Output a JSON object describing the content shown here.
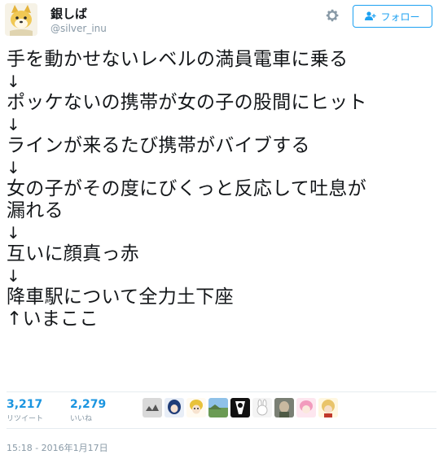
{
  "user": {
    "name": "銀しば",
    "handle": "@silver_inu",
    "follow_label": "フォロー"
  },
  "tweet": {
    "lines": [
      "手を動かせないレベルの満員電車に乗る",
      "↓",
      "ポッケないの携帯が女の子の股間にヒット",
      "↓",
      "ラインが来るたび携帯がバイブする",
      "↓",
      "女の子がその度にびくっと反応して吐息が",
      "漏れる",
      "↓",
      "互いに顔真っ赤",
      "↓",
      "降車駅について全力土下座",
      "↑いまここ"
    ]
  },
  "stats": {
    "retweets": "3,217",
    "retweets_label": "リツイート",
    "likes": "2,279",
    "likes_label": "いいね"
  },
  "likers": [
    {
      "icon": "avatar-gray"
    },
    {
      "icon": "avatar-anime-blue"
    },
    {
      "icon": "avatar-yellow-hair"
    },
    {
      "icon": "avatar-landscape"
    },
    {
      "icon": "avatar-black-white"
    },
    {
      "icon": "avatar-white-bunny"
    },
    {
      "icon": "avatar-figure"
    },
    {
      "icon": "avatar-pink"
    },
    {
      "icon": "avatar-blonde"
    }
  ],
  "timestamp": "15:18 - 2016年1月17日",
  "colors": {
    "accent": "#1da1f2",
    "stat_number": "#1b95e0",
    "muted": "#8899a6",
    "text": "#14171a"
  }
}
